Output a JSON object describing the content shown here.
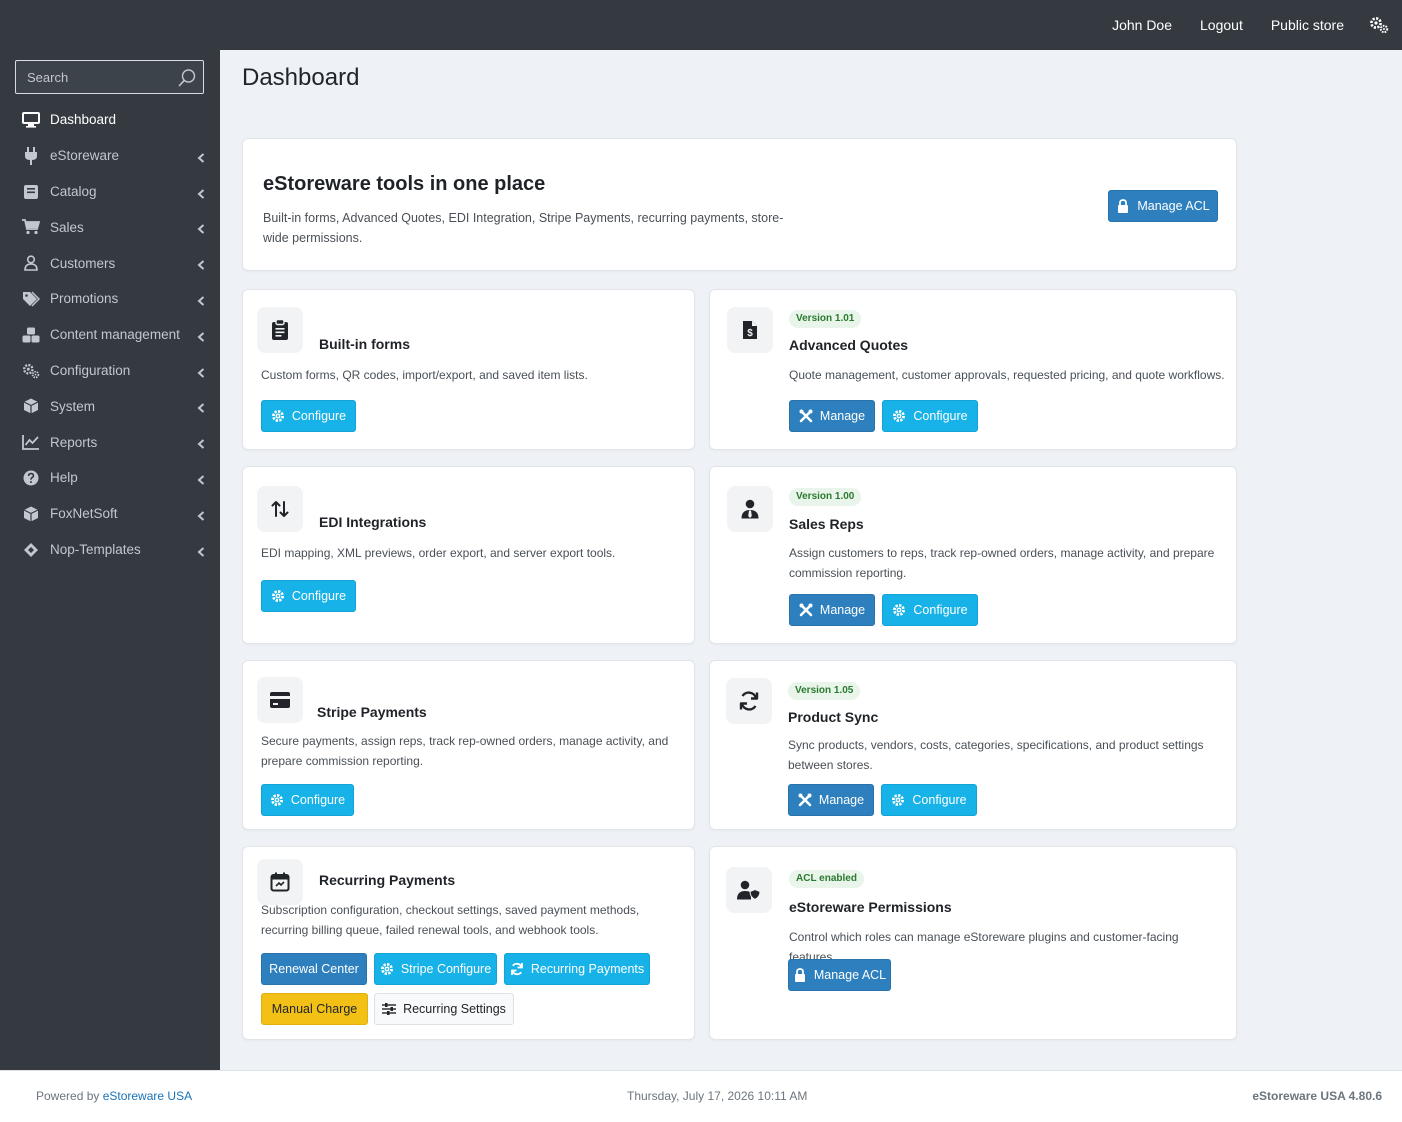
{
  "topbar": {
    "user_name": "John Doe",
    "logout": "Logout",
    "public_store": "Public store",
    "settings_icon": "gears-icon"
  },
  "sidebar": {
    "search_placeholder": "Search",
    "items": [
      {
        "label": "Dashboard",
        "icon": "monitor-icon",
        "active": true
      },
      {
        "label": "eStoreware",
        "icon": "plug-icon"
      },
      {
        "label": "Catalog",
        "icon": "book-icon"
      },
      {
        "label": "Sales",
        "icon": "cart-icon"
      },
      {
        "label": "Customers",
        "icon": "user-icon"
      },
      {
        "label": "Promotions",
        "icon": "tags-icon"
      },
      {
        "label": "Content management",
        "icon": "cubes-icon"
      },
      {
        "label": "Configuration",
        "icon": "gears-icon"
      },
      {
        "label": "System",
        "icon": "cube-icon"
      },
      {
        "label": "Reports",
        "icon": "line-chart-icon"
      },
      {
        "label": "Help",
        "icon": "question-circle-icon"
      },
      {
        "label": "FoxNetSoft",
        "icon": "cube-icon"
      },
      {
        "label": "Nop-Templates",
        "icon": "diamond-icon"
      }
    ]
  },
  "page": {
    "title": "Dashboard"
  },
  "hero": {
    "title": "eStoreware tools in one place",
    "description": "Built-in forms, Advanced Quotes, EDI Integration, Stripe Payments, recurring payments, store-wide permissions.",
    "button": "Manage ACL"
  },
  "tools": {
    "builtin_forms": {
      "title": "Built-in forms",
      "description": "Custom forms, QR codes, import/export, and saved item lists.",
      "configure": "Configure"
    },
    "advanced_quotes": {
      "badge": "Version 1.01",
      "title": "Advanced Quotes",
      "description": "Quote management, customer approvals, requested pricing, and quote workflows.",
      "manage": "Manage",
      "configure": "Configure"
    },
    "edi": {
      "title": "EDI Integrations",
      "description": "EDI mapping, XML previews, order export, and server export tools.",
      "configure": "Configure"
    },
    "sales_reps": {
      "badge": "Version 1.00",
      "title": "Sales Reps",
      "description": "Assign customers to reps, track rep-owned orders, manage activity, and prepare commission reporting.",
      "manage": "Manage",
      "configure": "Configure"
    },
    "stripe": {
      "title": "Stripe Payments",
      "description": "Secure payments, assign reps, track rep-owned orders, manage activity, and prepare commission reporting.",
      "configure": "Configure"
    },
    "product_sync": {
      "badge": "Version 1.05",
      "title": "Product Sync",
      "description": "Sync products, vendors, costs, categories, specifications, and product settings between stores.",
      "manage": "Manage",
      "configure": "Configure"
    },
    "recurring": {
      "title": "Recurring Payments",
      "description": "Subscription configuration, checkout settings, saved payment methods, recurring billing queue, failed renewal tools, and webhook tools.",
      "renewal_center": "Renewal Center",
      "stripe_configure": "Stripe Configure",
      "recurring_payments": "Recurring Payments",
      "manual_charge": "Manual Charge",
      "recurring_settings": "Recurring Settings"
    },
    "permissions": {
      "badge": "ACL enabled",
      "title": "eStoreware Permissions",
      "description": "Control which roles can manage eStoreware plugins and customer-facing features.",
      "button": "Manage ACL"
    }
  },
  "footer": {
    "powered_by": "Powered by ",
    "powered_link": "eStoreware USA",
    "datetime": "Thursday, July 17, 2026 10:11 AM",
    "version": "eStoreware USA 4.80.6"
  },
  "colors": {
    "sidebar_bg": "#343a40",
    "info_button": "#17b2e8",
    "primary_button": "#2d7fbd",
    "warning_button": "#f3c016",
    "badge_green": "#2b7a2f"
  }
}
